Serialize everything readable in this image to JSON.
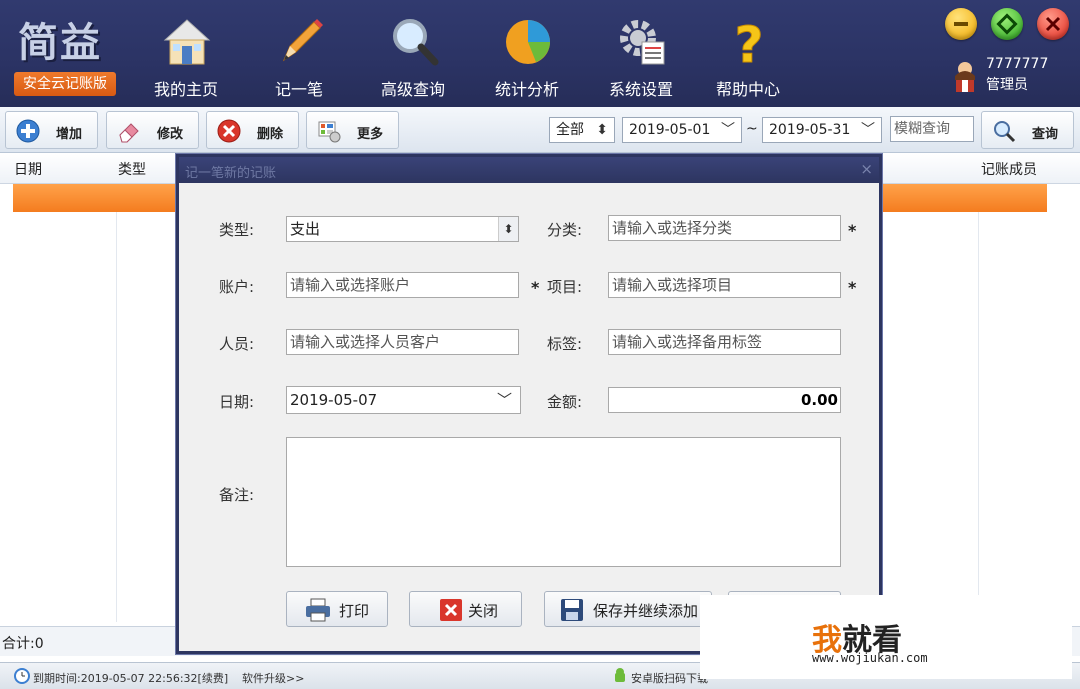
{
  "app": {
    "logo_text": "简益",
    "logo_subtitle": "安全云记账版"
  },
  "nav": [
    {
      "label": "我的主页",
      "icon": "home-icon"
    },
    {
      "label": "记一笔",
      "icon": "pencil-icon"
    },
    {
      "label": "高级查询",
      "icon": "magnifier-icon"
    },
    {
      "label": "统计分析",
      "icon": "pie-chart-icon"
    },
    {
      "label": "系统设置",
      "icon": "settings-gear-icon"
    },
    {
      "label": "帮助中心",
      "icon": "question-mark-icon"
    }
  ],
  "user": {
    "name": "7777777",
    "role": "管理员"
  },
  "toolbar": {
    "add_label": "增加",
    "edit_label": "修改",
    "delete_label": "删除",
    "more_label": "更多",
    "scope_value": "全部",
    "date_from": "2019-05-01",
    "range_sep": "~",
    "date_to": "2019-05-31",
    "fuzzy_placeholder": "模糊查询",
    "query_label": "查询"
  },
  "grid": {
    "columns": [
      "日期",
      "类型",
      "记账成员"
    ],
    "footer_total": "合计:0"
  },
  "dialog": {
    "title": "记一笔新的记账",
    "close_glyph": "×",
    "type_label": "类型:",
    "type_value": "支出",
    "category_label": "分类:",
    "category_placeholder": "请输入或选择分类",
    "account_label": "账户:",
    "account_placeholder": "请输入或选择账户",
    "project_label": "项目:",
    "project_placeholder": "请输入或选择项目",
    "person_label": "人员:",
    "person_placeholder": "请输入或选择人员客户",
    "tag_label": "标签:",
    "tag_placeholder": "请输入或选择备用标签",
    "date_label": "日期:",
    "date_value": "2019-05-07",
    "amount_label": "金额:",
    "amount_value": "0.00",
    "note_label": "备注:",
    "required_mark": "*",
    "print_label": "打印",
    "close_label": "关闭",
    "save_continue_label": "保存并继续添加"
  },
  "status": {
    "expire": "到期时间:2019-05-07 22:56:32[续费]",
    "upgrade": "软件升级>>",
    "android": "安卓版扫码下载"
  },
  "watermark": {
    "main_first": "我",
    "main_rest": "就看",
    "url": "www.wojiukan.com"
  },
  "colors": {
    "topbar": "#2b3364",
    "accent_orange": "#f47c1f",
    "dialog_frame": "#2d3560"
  }
}
